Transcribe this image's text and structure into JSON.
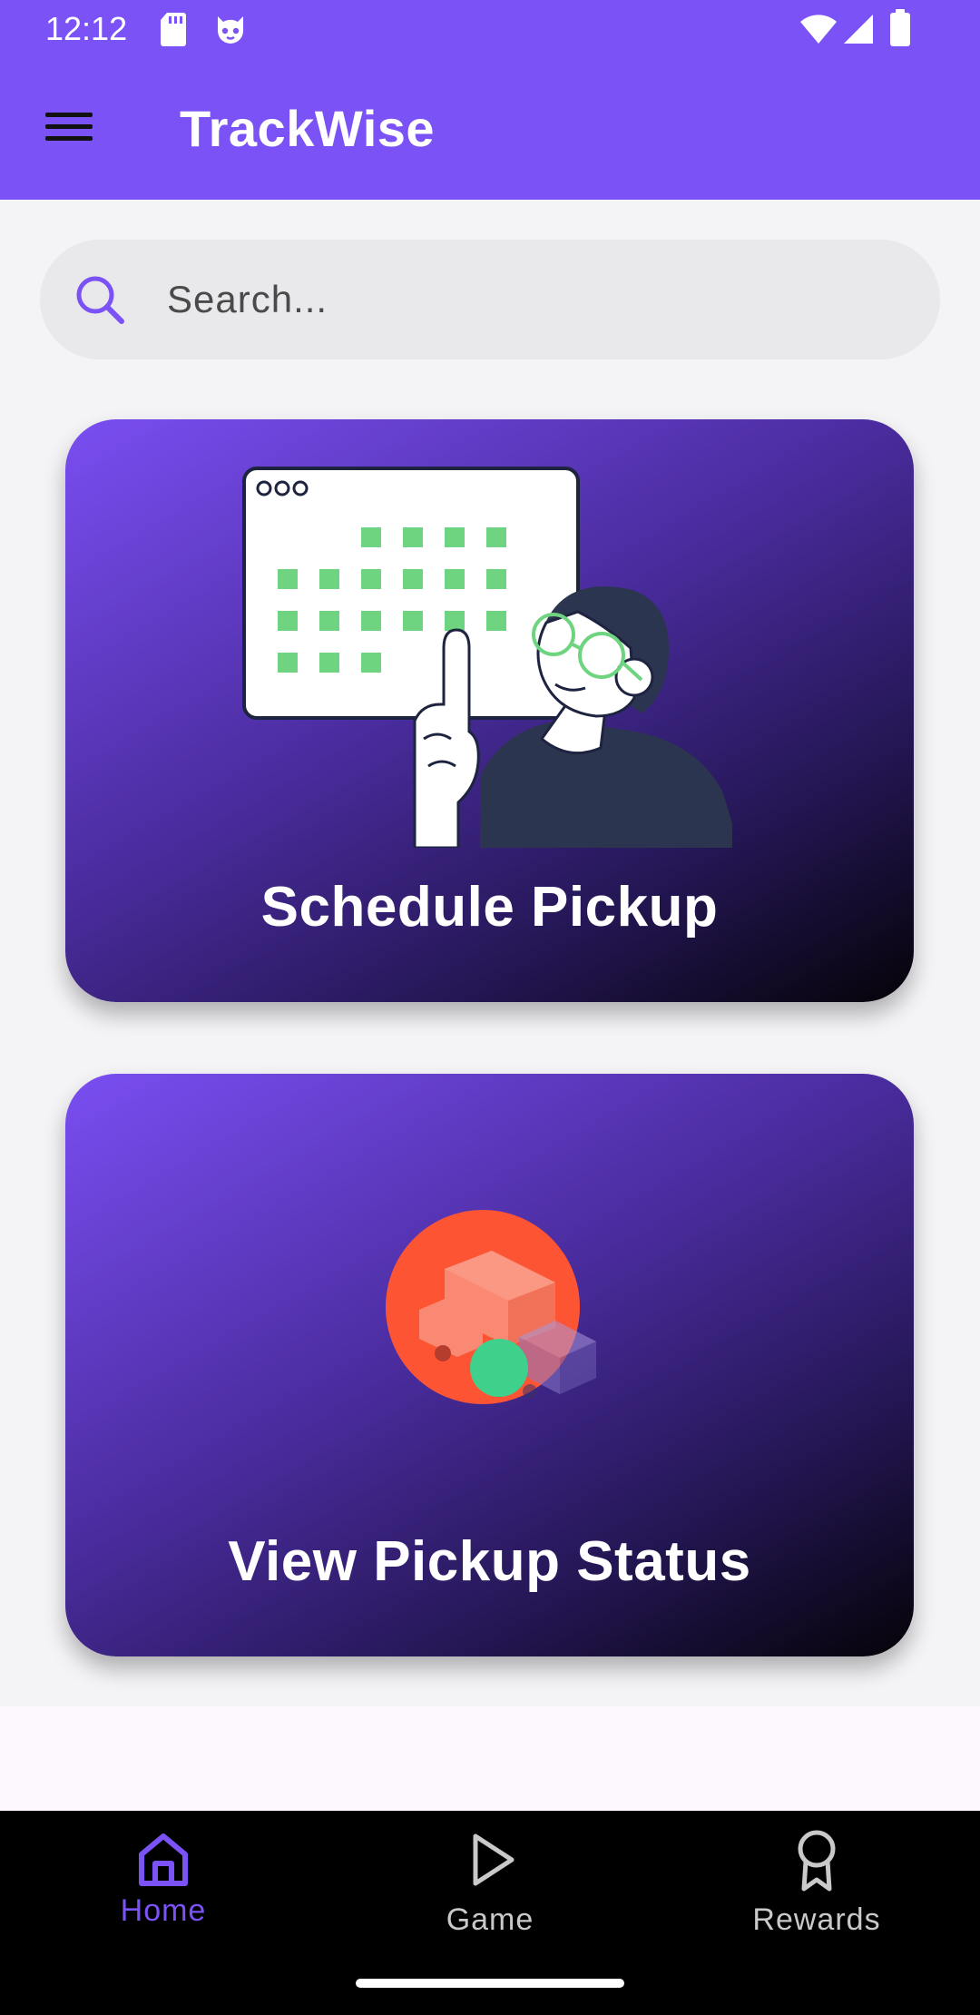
{
  "status_bar": {
    "time": "12:12",
    "icons": [
      "sd-card-icon",
      "debug-cat-icon",
      "wifi-icon",
      "signal-icon",
      "battery-icon"
    ]
  },
  "app_bar": {
    "title": "TrackWise",
    "menu_icon": "hamburger-menu-icon"
  },
  "search": {
    "placeholder": "Search...",
    "value": "",
    "icon": "search-icon"
  },
  "cards": [
    {
      "label": "Schedule Pickup",
      "illustration": "calendar-person-illustration"
    },
    {
      "label": "View Pickup Status",
      "illustration": "delivery-truck-illustration"
    }
  ],
  "bottom_nav": {
    "items": [
      {
        "label": "Home",
        "icon": "home-icon",
        "active": true
      },
      {
        "label": "Game",
        "icon": "play-icon",
        "active": false
      },
      {
        "label": "Rewards",
        "icon": "award-ribbon-icon",
        "active": false
      }
    ]
  },
  "colors": {
    "primary": "#7B52F5",
    "card_gradient_start": "#7A4EF2",
    "card_gradient_end": "#050308",
    "calendar_square": "#6FD47F",
    "status_circle": "#FD5534",
    "status_dot": "#3FD08C",
    "nav_background": "#000000",
    "nav_inactive": "#C9C9C9"
  }
}
